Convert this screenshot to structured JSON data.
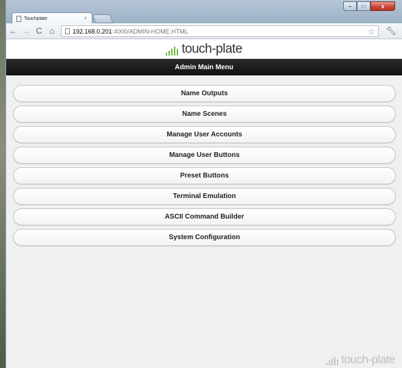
{
  "browser": {
    "tab_title": "Touchplate",
    "tab_close": "×",
    "url_host": "192.168.0.201",
    "url_path": ":4000/ADMIN-HOME.HTML",
    "controls": {
      "minimize": "–",
      "maximize": "□",
      "close": "x"
    }
  },
  "page": {
    "logo_text": "touch-plate",
    "header_title": "Admin Main Menu",
    "menu_items": [
      "Name Outputs",
      "Name Scenes",
      "Manage User Accounts",
      "Manage User Buttons",
      "Preset Buttons",
      "Terminal Emulation",
      "ASCII Command Builder",
      "System Configuration"
    ],
    "footer_logo_text": "touch-plate"
  },
  "colors": {
    "logo_green": "#6bb83a",
    "header_bg": "#1a1a1a",
    "page_bg": "#f0f0f0"
  },
  "icons": [
    "back-arrow-icon",
    "forward-arrow-icon",
    "reload-icon",
    "home-icon",
    "page-icon",
    "star-icon",
    "wrench-icon"
  ]
}
